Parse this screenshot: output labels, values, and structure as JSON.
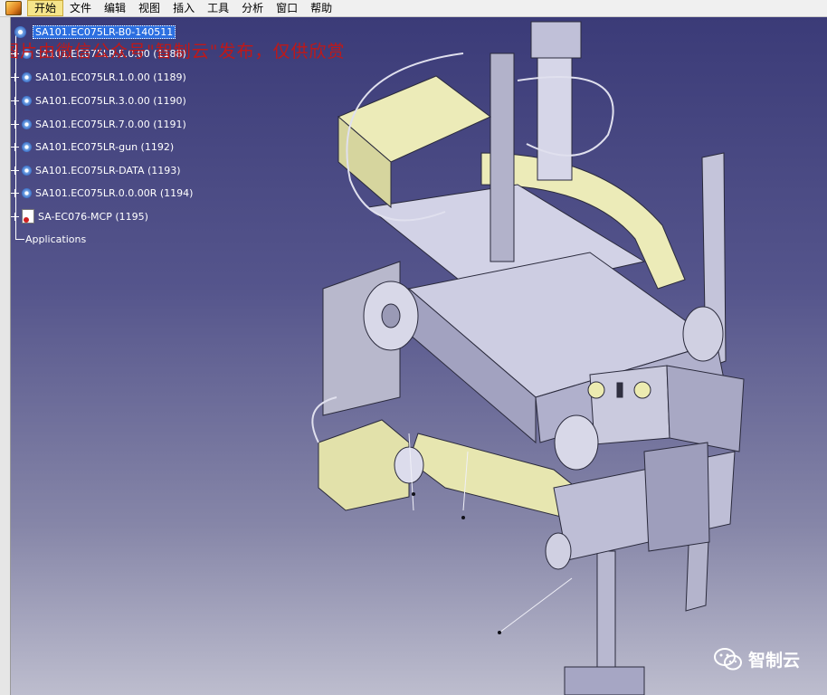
{
  "menu": {
    "items": [
      "开始",
      "文件",
      "编辑",
      "视图",
      "插入",
      "工具",
      "分析",
      "窗口",
      "帮助"
    ],
    "active_index": 0
  },
  "tree": {
    "root": "SA101.EC075LR-B0-140511",
    "children": [
      "SA101.EC075LR.5.0.00 (1188)",
      "SA101.EC075LR.1.0.00 (1189)",
      "SA101.EC075LR.3.0.00 (1190)",
      "SA101.EC075LR.7.0.00 (1191)",
      "SA101.EC075LR-gun (1192)",
      "SA101.EC075LR-DATA (1193)",
      "SA101.EC075LR.0.0.00R (1194)",
      "SA-EC076-MCP (1195)"
    ],
    "applications": "Applications"
  },
  "watermark": "图片由微信公众号\"智制云\"发布，仅供欣赏",
  "brand": {
    "name": "智制云",
    "logo": "wechat-icon"
  },
  "colors": {
    "menu_active": "#f6e58a",
    "tree_selected": "#2c6fe0",
    "viewport_top": "#3b3b78",
    "viewport_bottom": "#bdbdce",
    "part_grey": "#c8c8dc",
    "part_yellow": "#ecebb8"
  }
}
